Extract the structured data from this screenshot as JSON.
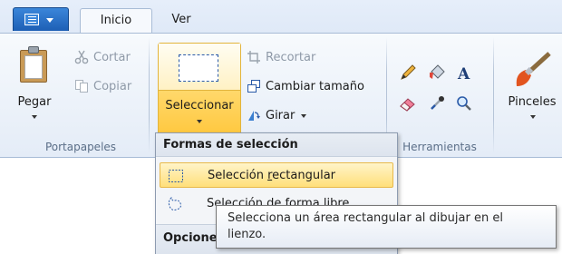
{
  "tabs": {
    "home": "Inicio",
    "view": "Ver"
  },
  "clipboard": {
    "paste": "Pegar",
    "cut": "Cortar",
    "copy": "Copiar",
    "group": "Portapapeles"
  },
  "image": {
    "select": "Seleccionar",
    "crop": "Recortar",
    "resize": "Cambiar tamaño",
    "rotate": "Girar"
  },
  "tools": {
    "group": "Herramientas"
  },
  "brushes": {
    "label": "Pinceles"
  },
  "dropdown": {
    "header": "Formas de selección",
    "items": [
      {
        "label_before": "Selección ",
        "label_ul": "r",
        "label_after": "ectangular"
      },
      {
        "label": "Selección de forma libre"
      }
    ],
    "options_header": "Opciones"
  },
  "tooltip": {
    "line1": "Selecciona un área rectangular al dibujar en el",
    "line2": "lienzo."
  },
  "colors": {
    "accent": "#1d5fb5",
    "highlight": "#ffd86b",
    "highlight_border": "#e2b43c"
  }
}
